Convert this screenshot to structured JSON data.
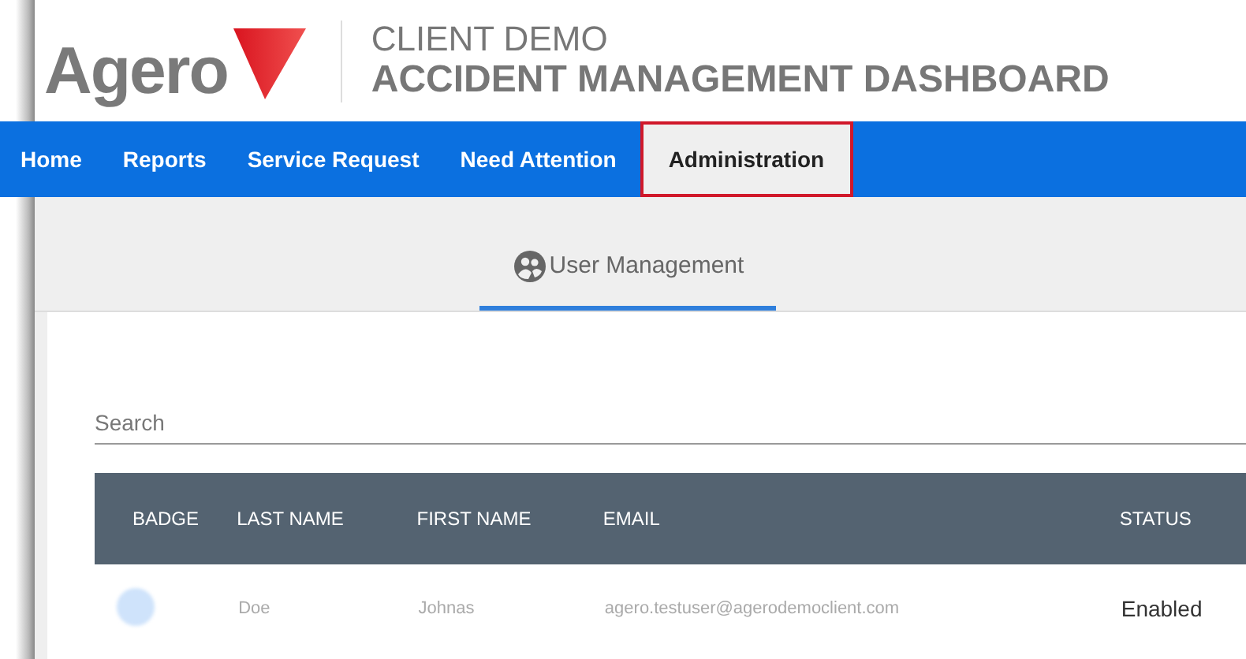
{
  "header": {
    "logo_text": "Agero",
    "client": "CLIENT DEMO",
    "title": "ACCIDENT MANAGEMENT DASHBOARD"
  },
  "nav": [
    {
      "label": "Home",
      "selected": false
    },
    {
      "label": "Reports",
      "selected": false
    },
    {
      "label": "Service Request",
      "selected": false
    },
    {
      "label": "Need Attention",
      "selected": false
    },
    {
      "label": "Administration",
      "selected": true
    }
  ],
  "tabs": [
    {
      "label": "User Management",
      "selected": true
    }
  ],
  "search": {
    "placeholder": "Search"
  },
  "table": {
    "columns": [
      "BADGE",
      "LAST NAME",
      "FIRST NAME",
      "EMAIL",
      "STATUS"
    ],
    "rows": [
      {
        "last_name": "Doe",
        "first_name": "Johnas",
        "email": "agero.testuser@agerodemoclient.com",
        "status": "Enabled"
      }
    ]
  }
}
